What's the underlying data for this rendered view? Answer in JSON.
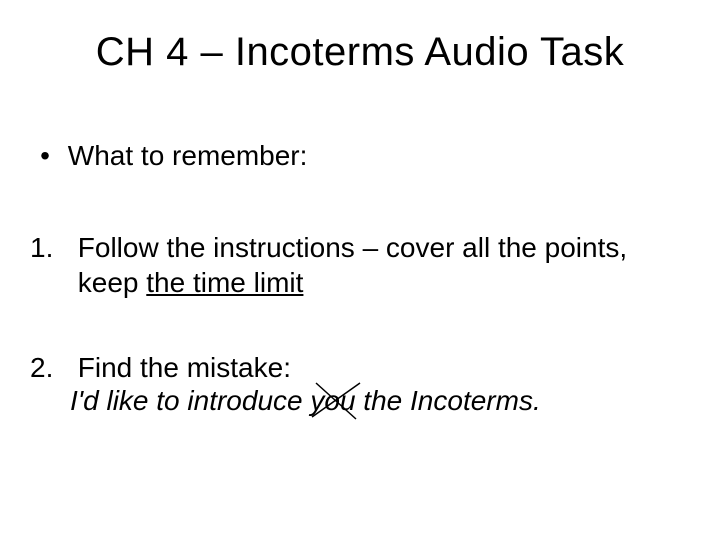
{
  "title": "CH 4 – Incoterms Audio Task",
  "bullet": {
    "dot": "•",
    "text": "What to remember:"
  },
  "items": [
    {
      "marker": "1.",
      "text_pre": "Follow the instructions – cover all the points, keep ",
      "underlined": "the time limit"
    },
    {
      "marker": "2.",
      "text": "Find the mistake:"
    }
  ],
  "mistake": {
    "pre": "I'd like to introduce ",
    "struck": "you",
    "post": " the Incoterms."
  }
}
